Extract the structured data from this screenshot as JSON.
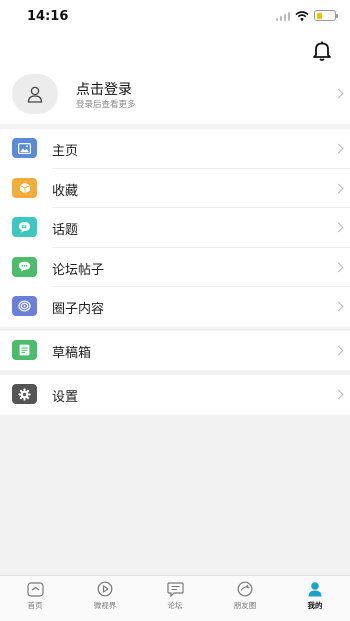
{
  "status_bar": {
    "time": "14:16"
  },
  "profile": {
    "title": "点击登录",
    "subtitle": "登录后查看更多"
  },
  "menu": {
    "group1": [
      {
        "label": "主页",
        "icon": "image-icon",
        "color": "#5b8bd6"
      },
      {
        "label": "收藏",
        "icon": "cube-icon",
        "color": "#f2ad3c"
      },
      {
        "label": "话题",
        "icon": "topic-icon",
        "color": "#3cc7c0"
      },
      {
        "label": "论坛帖子",
        "icon": "chat-icon",
        "color": "#4cbb6c"
      },
      {
        "label": "圈子内容",
        "icon": "circle-icon",
        "color": "#6b7fd8"
      }
    ],
    "drafts": {
      "label": "草稿箱",
      "icon": "draft-icon",
      "color": "#4cbb6c"
    },
    "settings": {
      "label": "设置",
      "icon": "gear-icon",
      "color": "#555555"
    }
  },
  "tabs": [
    {
      "label": "首页",
      "icon": "home-icon"
    },
    {
      "label": "微视界",
      "icon": "play-icon"
    },
    {
      "label": "论坛",
      "icon": "forum-icon"
    },
    {
      "label": "朋友圈",
      "icon": "moments-icon"
    },
    {
      "label": "我的",
      "icon": "user-icon",
      "active": true
    }
  ],
  "colors": {
    "accent": "#1aa3c8",
    "background": "#f2f2f2"
  }
}
